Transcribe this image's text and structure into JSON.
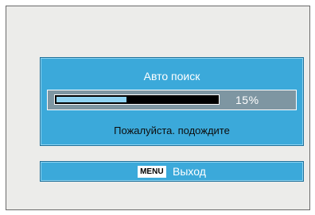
{
  "colors": {
    "panel": "#3ba9da",
    "panel_border": "#1d6f99",
    "progress_row_bg": "#7e96a2",
    "progress_track": "#000000",
    "progress_fill": "#8fd3f2",
    "screen_bg": "#ececea"
  },
  "dialog": {
    "title": "Авто поиск",
    "progress_value": 15,
    "progress_label": "15%",
    "status": "Пожалуйста. подождите"
  },
  "footer": {
    "key_label": "MENU",
    "action_label": "Выход"
  }
}
